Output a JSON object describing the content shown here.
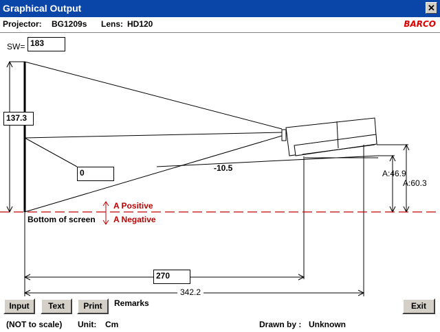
{
  "window": {
    "title": "Graphical Output",
    "close_glyph": "✕"
  },
  "info": {
    "projector_label": "Projector:",
    "projector_value": "BG1209s",
    "lens_label": "Lens:",
    "lens_value": "HD120",
    "brand": "BARCO"
  },
  "drawing": {
    "sw_label": "SW=",
    "sw_value": "183",
    "screen_height": "137.3",
    "projector_offset": "0",
    "tilt_angle": "-10.5",
    "a_small": "A:46.9",
    "a_large": "A:60.3",
    "bottom_label": "Bottom of screen",
    "a_positive": "A Positive",
    "a_negative": "A Negative",
    "distance_lens": "270",
    "distance_total": "342.2"
  },
  "buttons": {
    "input": "Input",
    "text": "Text",
    "print": "Print",
    "remarks": "Remarks",
    "exit": "Exit"
  },
  "footer": {
    "scale": "(NOT to scale)",
    "unit_label": "Unit:",
    "unit_value": "Cm",
    "drawn_label": "Drawn by :",
    "drawn_value": "Unknown"
  },
  "colors": {
    "titlebar": "#0a46a8",
    "accent_red": "#c00000"
  }
}
